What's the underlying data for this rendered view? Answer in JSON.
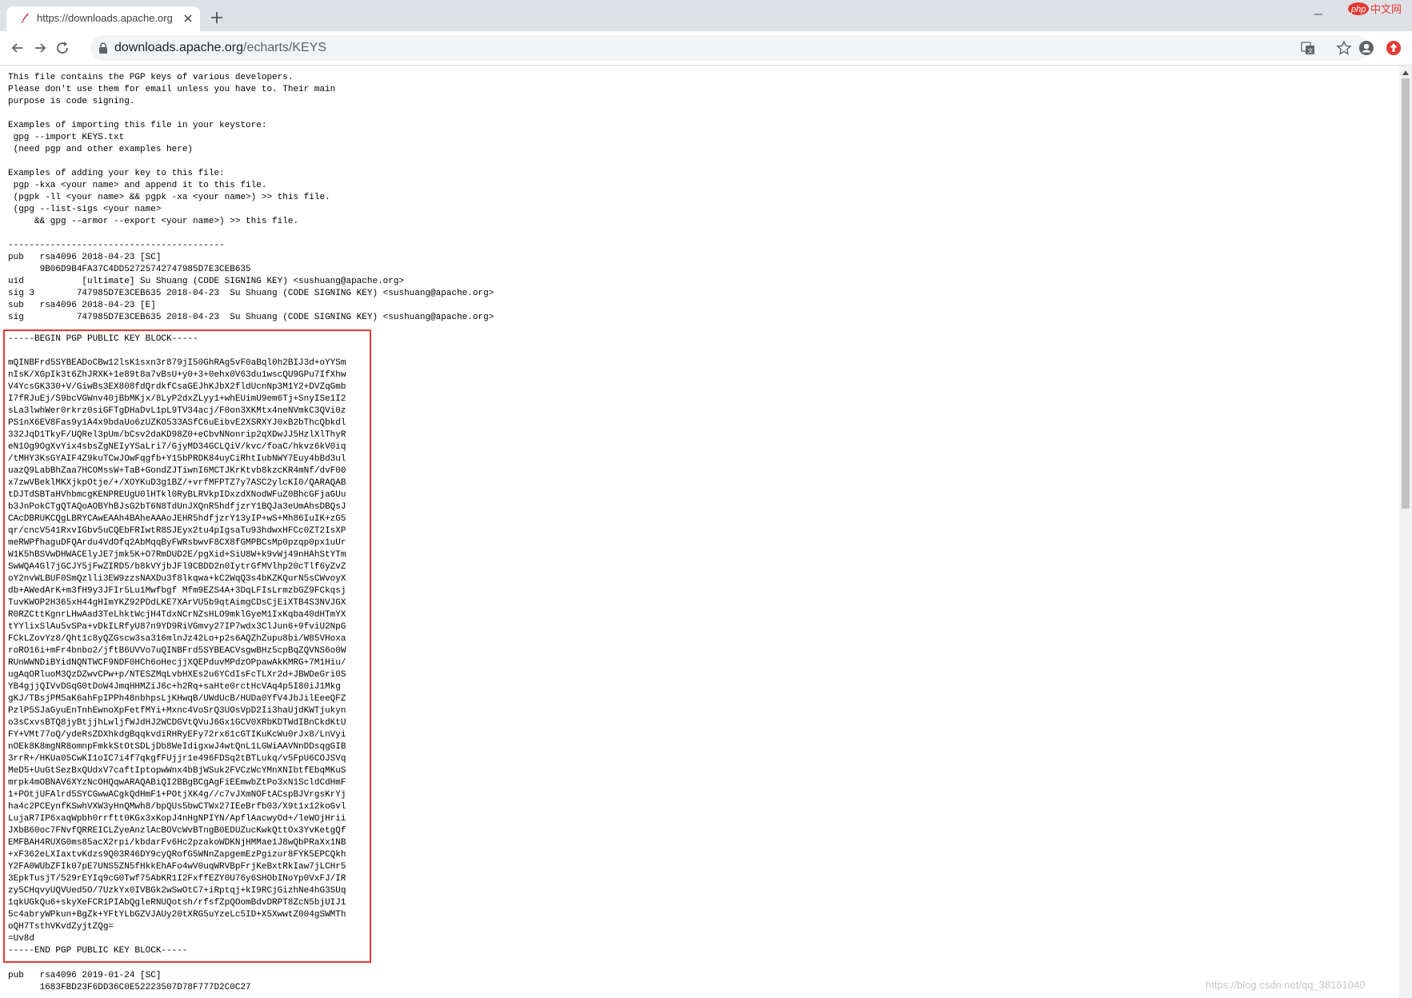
{
  "browser": {
    "tab_title": "https://downloads.apache.org",
    "url_host": "downloads.apache.org",
    "url_path": "/echarts/KEYS",
    "icons": [
      "apache-feather-favicon",
      "close-icon",
      "plus-icon",
      "minimize-icon",
      "back-arrow-icon",
      "forward-arrow-icon",
      "reload-icon",
      "lock-icon",
      "translate-icon",
      "star-icon",
      "profile-icon",
      "extension-icon"
    ],
    "watermark_logo": "php中文网"
  },
  "page": {
    "header_text": "This file contains the PGP keys of various developers.\nPlease don't use them for email unless you have to. Their main\npurpose is code signing.\n\nExamples of importing this file in your keystore:\n gpg --import KEYS.txt\n (need pgp and other examples here)\n\nExamples of adding your key to this file:\n pgp -kxa <your name> and append it to this file.\n (pgpk -ll <your name> && pgpk -xa <your name>) >> this file.\n (gpg --list-sigs <your name>\n     && gpg --armor --export <your name>) >> this file.\n\n-----------------------------------------\npub   rsa4096 2018-04-23 [SC]\n      9B06D9B4FA37C4DD52725742747985D7E3CEB635\nuid           [ultimate] Su Shuang (CODE SIGNING KEY) <sushuang@apache.org>\nsig 3        747985D7E3CEB635 2018-04-23  Su Shuang (CODE SIGNING KEY) <sushuang@apache.org>\nsub   rsa4096 2018-04-23 [E]\nsig          747985D7E3CEB635 2018-04-23  Su Shuang (CODE SIGNING KEY) <sushuang@apache.org>",
    "pgp_block": "-----BEGIN PGP PUBLIC KEY BLOCK-----\n\nmQINBFrd5SYBEADoCBw12lsK1sxn3r879jI50GhRAg5vF0aBql0h2BIJ3d+oYYSm\nnIsK/XGpIk3t6ZhJRXK+1e89t8a7vBsU+y0+3+0ehx0V63du1wscQU9GPu7IfXhw\nV4YcsGK330+V/GiwBs3EX808fdQrdkfCsaGEJhKJbX2fldUcnNp3M1Y2+DVZqGmb\nI7fRJuEj/S9bcVGWnv40jBbMKjx/8LyP2dxZLyy1+whEUimU9em6Tj+SnyISe1I2\nsLa3lwhWer0rkrz0siGFTgDHaDvL1pL9TV34acj/F0on3XKMtx4neNVmkC3QVi0z\nPS1nX6EV8Fas9y1A4x9bdaUo6zUZKO533ASfC6uEibvE2XSRXYJ0xB2bThcQbkdl\n332JqD1TkyF/UQRel3pUm/bCsv2daKD98Z0+eCbvNNonrip2qXDwJJ5HzlXlThyR\neN1Og9OgXvYix4sbsZgNEIyYSaLri7/GjyMD34GCLQiV/kvc/foaC/hkvz6kV0iq\n/tMHY3KsGYAIF4Z9kuTCwJOwFqgfb+Y15bPRDK84uyCiRhtIubNWY7Euy4bBd3ul\nuazQ9LabBhZaa7HCOMssW+TaB+GondZJTiwnI6MCTJKrKtvb8kzcKR4mNf/dvF00\nx7zwVBeklMKXjkpOtje/+/XOYKuD3g1BZ/+vrfMFPTZ7y7ASC2ylcKI0/QARAQAB\ntDJTdSBTaHVhbmcgKENPREUgU0lHTkl0RyBLRVkpIDxzdXNodWFuZ0BhcGFjaGUu\nb3JnPokCTgQTAQoAOBYhBJsG2bT6N8TdUnJXQnR5hdfjzrY1BQJa3eUmAhsDBQsJ\nCAcDBRUKCQgLBRYCAwEAAh4BAheAAAoJEHR5hdfjzrY13yIP+wS+Mh86IuIK+zG5\nqr/cncV541RxvIGbv5uCQEbFRIwtR8SJEyx2tu4pIgsaTu93hdwxHFCc0ZT2IsXP\nmeRWPfhaguDFQArdu4VdOfq2AbMqqByFWRsbwvF8CX8fGMPBCsMp0pzqp0px1uUr\nW1K5hBSVwDHWACElyJE7jmk5K+O7RmDUD2E/pgXid+SiU8W+k9vWj49nHAhStYTm\nSwWQA4Gl7jGCJY5jFwZIRD5/b8kVYjbJFl9CBDD2n0IytrGfMVlhp20cTlf6yZvZ\noY2nvWLBUF0SmQzlli3EW9zzsNAXDu3f8lkqwa+kC2WqQ3s4bKZKQurN5sCWvoyX\ndb+AWedArK+m3fH9y3JFIr5Lu1Mwfbgf Mfm9EZS4A+3DqLFIsLrmzbGZ9FCkqsj\nTuvKWOP2H365xH44gHImYKZ92PDdLKE7XArVU5b9qtAimgCDsCjEiXTB4S3NVJGX\nR0RZCttKgnrLHwAad3TeLhktWcjH4TdxNCrNZsHLO9mklGyeM1IxKqba40dHTmYX\ntYYlixSlAu5vSPa+vDkILRfyU87n9YD9RiVGmvy27IP7wdx3ClJun6+9fviU2NpG\nFCkLZovYz8/Qht1c8yQZGscw3sa316mlnJz42Lo+p2s6AQZhZupu8bi/W85VHoxa\nroRO16i+mFr4bnbo2/jftB6UVVo7uQINBFrd5SYBEACVsgwBHz5cpBqZQVNS6o0W\nRUnWWNDiBYidNQNTWCF9NDF0HCh6oHecjjXQEPduvMPdzOPpawAkKMRG+7M1Hiu/\nugAqORluoM3QzDZwvCPw+p/NTESZMqLvbHXEs2u6YCdIsFcTLXr2d+JBWDeGri0S\nYB4gjjQIVvDGqG0tDoW4JmqHHMZiJ6c+h2Rq+saHte0rctHcVAq4p5I80iJ1Mkg\ngKJ/TBsjPM5aK6ahFpIPPh48nbhpsLjKHwqB/UWdUcB/HUDa0YfV4JbJilEeeQFZ\nPzlP5SJaGyuEnTnhEwnoXpFetfMYi+Mxnc4VoSrQ3UOsVpD2Ii3haUjdKWTjukyn\no3sCxvsBTQ8jyBtjjhLwljfWJdHJ2WCDGVtQVuJ6Gx1GCV0XRbKDTWdIBnCkdKtU\nFY+VMt77oQ/ydeRsZDXhkdgBqqkvdiRHRyEFy72rx61cGTIKuKcWu0rJx8/LnVyi\nnOEk8K8mgNR8omnpFmkkStOtSDLjDb8WeIdigxwJ4wtQnL1LGWiAAVNnDDsqgGIB\n3rrR+/HKUa05CwKI1oIC7i4f7qkgfFUjjr1e496FDSq2tBTLukq/v5FpU6COJSVq\nMeD5+UuGtSezBxQUdxV7caftIptopwWnx4bBjWSuk2FVCzWcYMnXNIbtfEbqMKuS\nmrpk4mOBNAV6XYzNcOHQqwARAQABiQI2BBgBCgAgFiEEmwbZtPo3xN1ScldCdHmF\n1+POtjUFAlrd5SYCGwwACgkQdHmF1+POtjXK4g//c7vJXmNOFtACspBJVrgsKrYj\nha4c2PCEynfKSwhVXW3yHnQMwh8/bpQUs5bwCTWx27IEeBrfb03/X9t1x12koGvl\nLujaR7IP6xaqWpbh0rrftt0KGx3xKopJ4nHgNPIYN/ApflAacwyOd+/leWOjHrii\nJXbB60oc7FNvfQRREICLZyeAnzlAcBOVcWvBTngB0EDUZucKwkQttOx3YvKetgQf\nEMFBAH4RUXG0ms85acX2rpi/kbdarFv6Hc2pzakoWDKNjHMMae1J8wQbPRaXx1NB\n+xF362eLXIaxtvKdzs9Q03R46DY9cyQRofG5WNnZapgemEzPgizur8FYK5EPCQkh\nY2FA0WUbZFIk07pE7UNS5ZN5fHkkEhAFo4wV0uqWRVBpFrjKeBxtRkIaw7jLCHr5\n3EpkTusjT/529rEYIq9cG0Twf75AbKR1I2FxffEZY0U76y6SHObINoYp0VxFJ/IR\nzy5CHqvyUQVUed5O/7UzkYx0IVBGk2wSwOtC7+iRptqj+kI9RCjGizhNe4hG3SUq\n1qkUGkQu6+skyXeFCR1PIAbQgleRNUQotsh/rfsfZpQOomBdvDRPT8ZcN5bjUIJ1\n5c4abryWPkun+BgZk+YFtYLbGZVJAUy20tXRG5uYzeLc5ID+X5XwwtZ004gSWMTh\noQH7TsthVKvdZyjtZQg=\n=Uv8d\n-----END PGP PUBLIC KEY BLOCK-----",
    "next_key_text": "pub   rsa4096 2019-01-24 [SC]\n      1683FBD23F6DD36C0E52223507D78F777D2C0C27"
  },
  "overlay": {
    "csdn_watermark": "https://blog.csdn.net/qq_38161040",
    "highlight_color": "#e53935"
  }
}
